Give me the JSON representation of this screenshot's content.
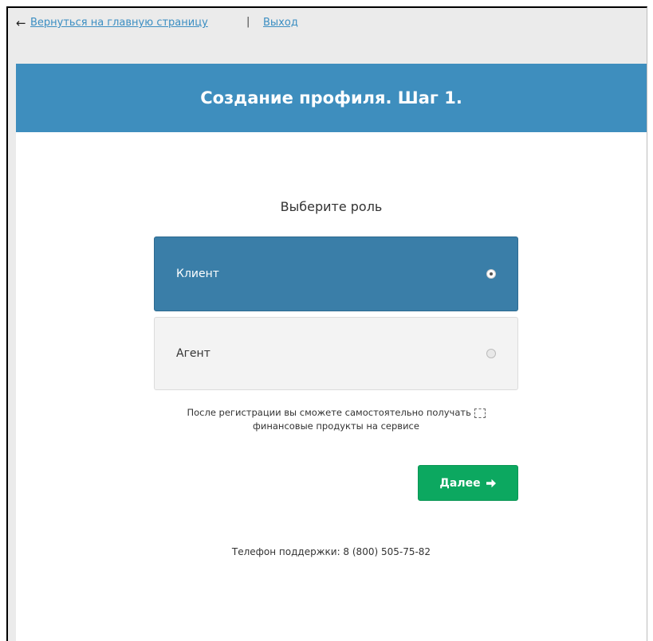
{
  "nav": {
    "back_icon": "arrow-left-icon",
    "home_link": "Вернуться на главную страницу",
    "separator": "|",
    "logout_link": "Выход"
  },
  "header": {
    "title": "Создание профиля. Шаг 1."
  },
  "role_prompt": "Выберите роль",
  "roles": [
    {
      "label": "Клиент",
      "selected": true
    },
    {
      "label": "Агент",
      "selected": false
    }
  ],
  "note": {
    "line1": "После регистрации вы сможете самостоятельно получать",
    "line2": "финансовые продукты на сервисе"
  },
  "next_button": {
    "label": "Далее",
    "icon": "arrow-right-icon"
  },
  "support_phone": "Телефон поддержки: 8 (800) 505-75-82",
  "colors": {
    "header_bg": "#3e8ebe",
    "selected_option_bg": "#3a7ea8",
    "button_green": "#0ca860",
    "link": "#3b8ec2"
  }
}
